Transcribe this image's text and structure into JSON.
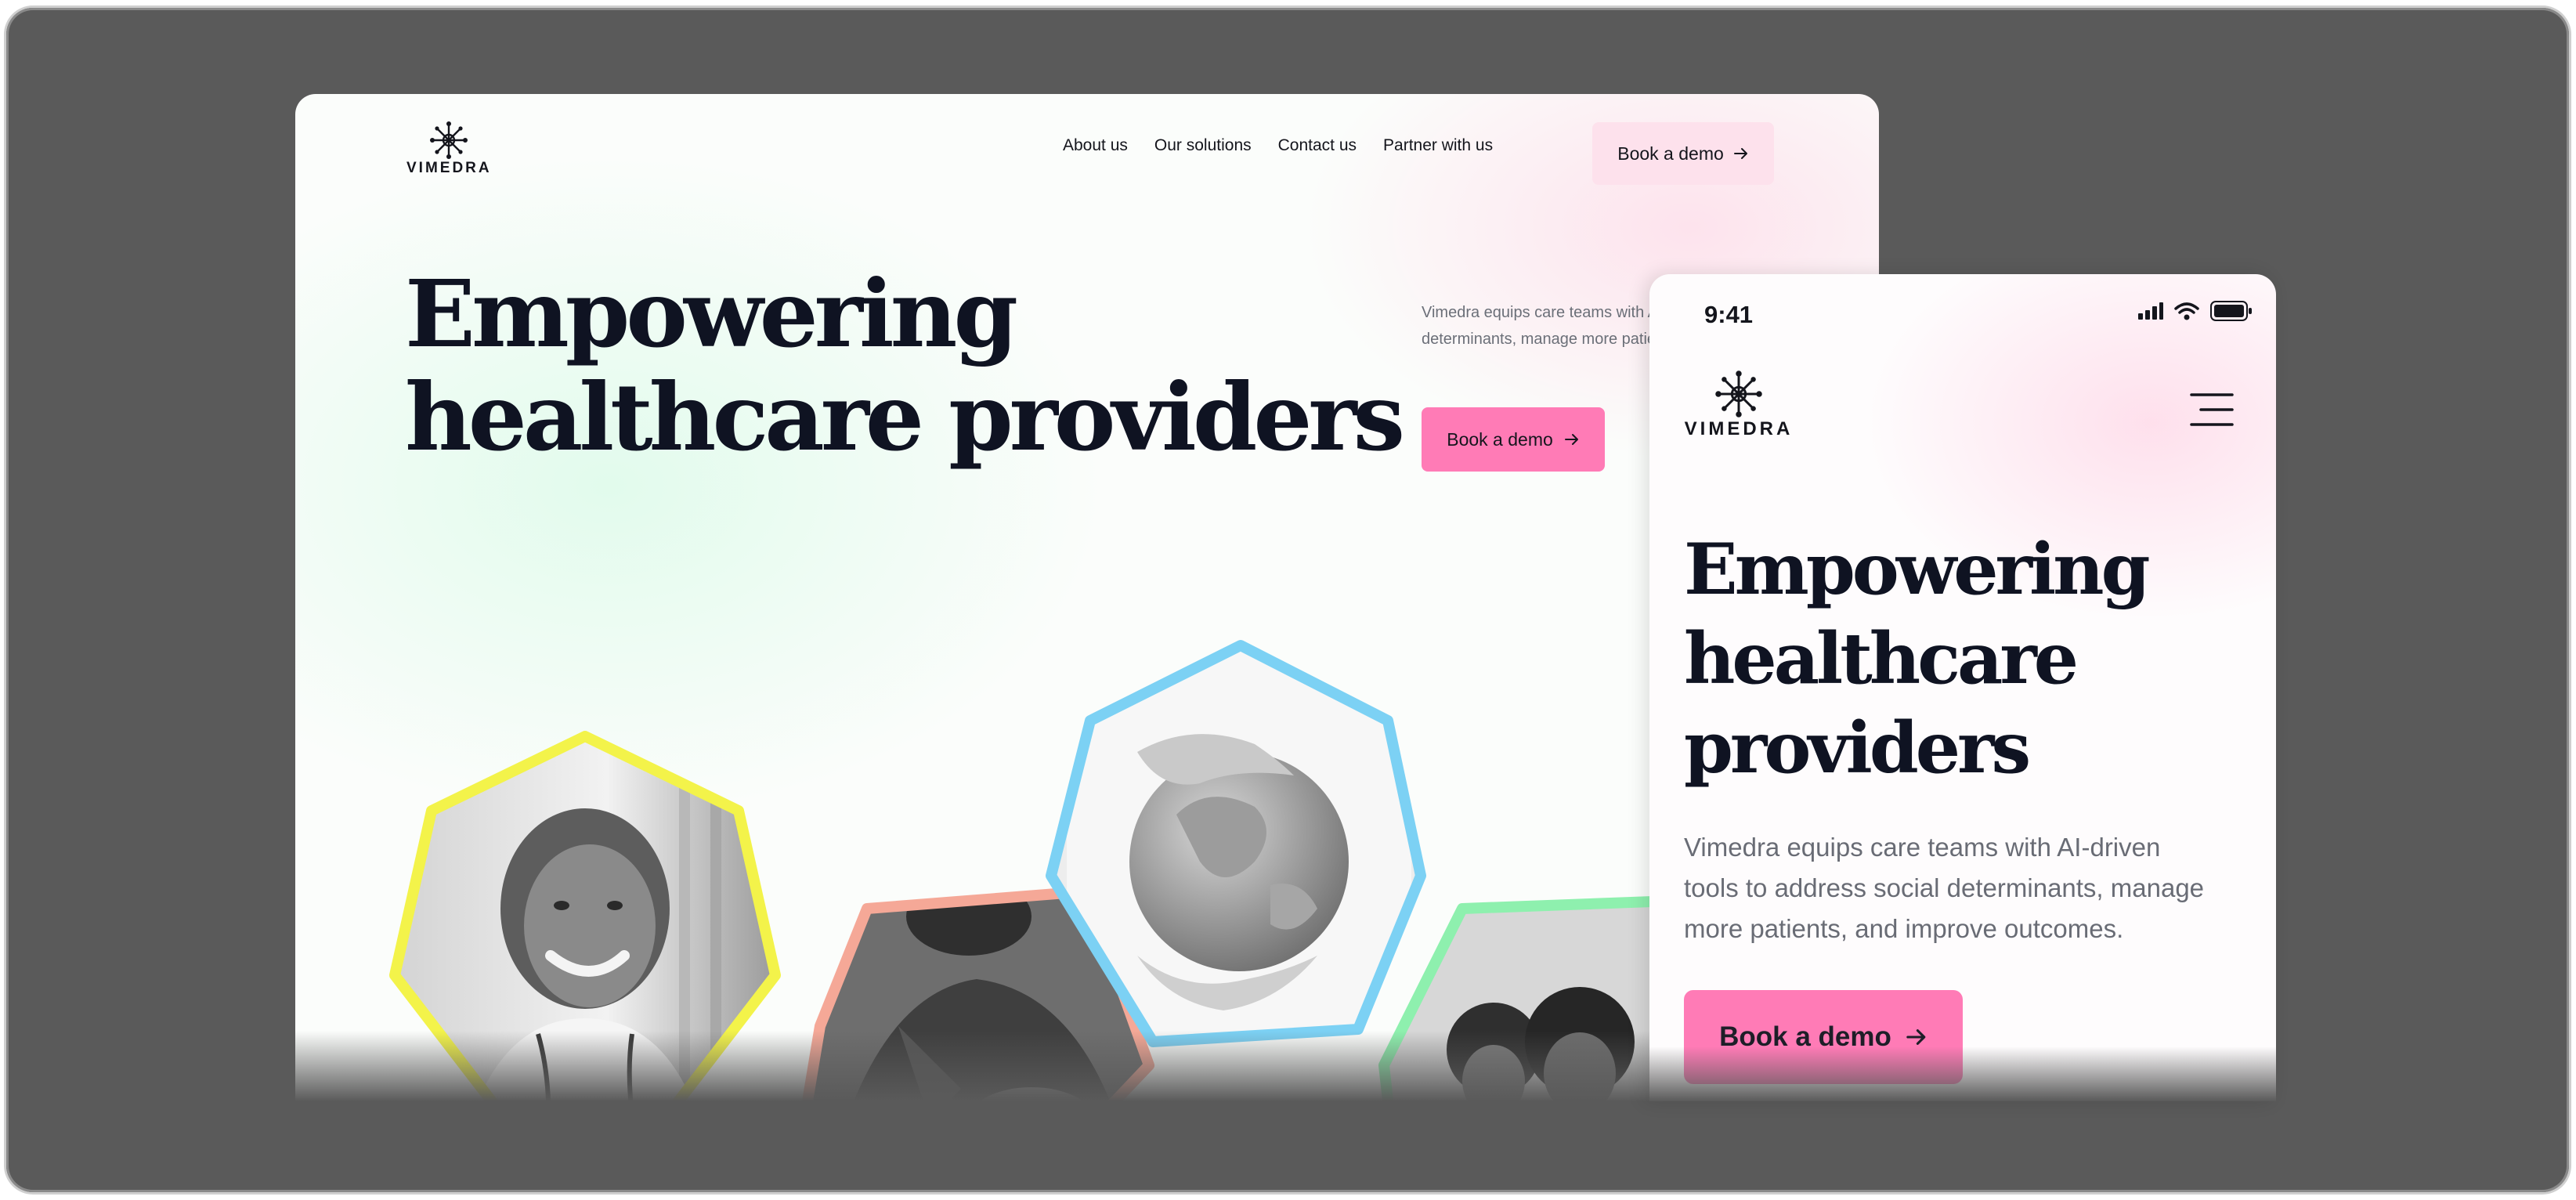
{
  "brand": {
    "name": "VIMEDRA",
    "logo_icon": "snowflake-cross-logo-icon"
  },
  "desktop": {
    "nav": [
      "About us",
      "Our solutions",
      "Contact us",
      "Partner with us"
    ],
    "header_cta": "Book a demo",
    "hero_title_line1": "Empowering",
    "hero_title_line2": "healthcare providers",
    "hero_description": "Vimedra equips care teams with AI-driven tools to address social determinants, manage more patients, and improve outcomes.",
    "hero_cta": "Book a demo",
    "images": [
      {
        "name": "smiling-doctor-photo",
        "border": "#f3f34a"
      },
      {
        "name": "man-hand-on-chest-photo",
        "border": "#f5a897"
      },
      {
        "name": "hands-holding-globe-photo",
        "border": "#7cd1f4"
      },
      {
        "name": "group-of-people-photo",
        "border": "#8ef0ae"
      }
    ]
  },
  "mobile": {
    "status_time": "9:41",
    "status_icons": [
      "signal-icon",
      "wifi-icon",
      "battery-icon"
    ],
    "menu_icon": "hamburger-menu-icon",
    "hero_title_line1": "Empowering",
    "hero_title_line2": "healthcare",
    "hero_title_line3": "providers",
    "hero_description": "Vimedra equips care teams with AI-driven tools to address social determinants, manage more patients, and improve outcomes.",
    "hero_cta": "Book a demo"
  },
  "colors": {
    "frame": "#5a5a5a",
    "accent_pink": "#ff7bb6",
    "soft_pink": "#fde1ec",
    "heading": "#0f1322"
  }
}
